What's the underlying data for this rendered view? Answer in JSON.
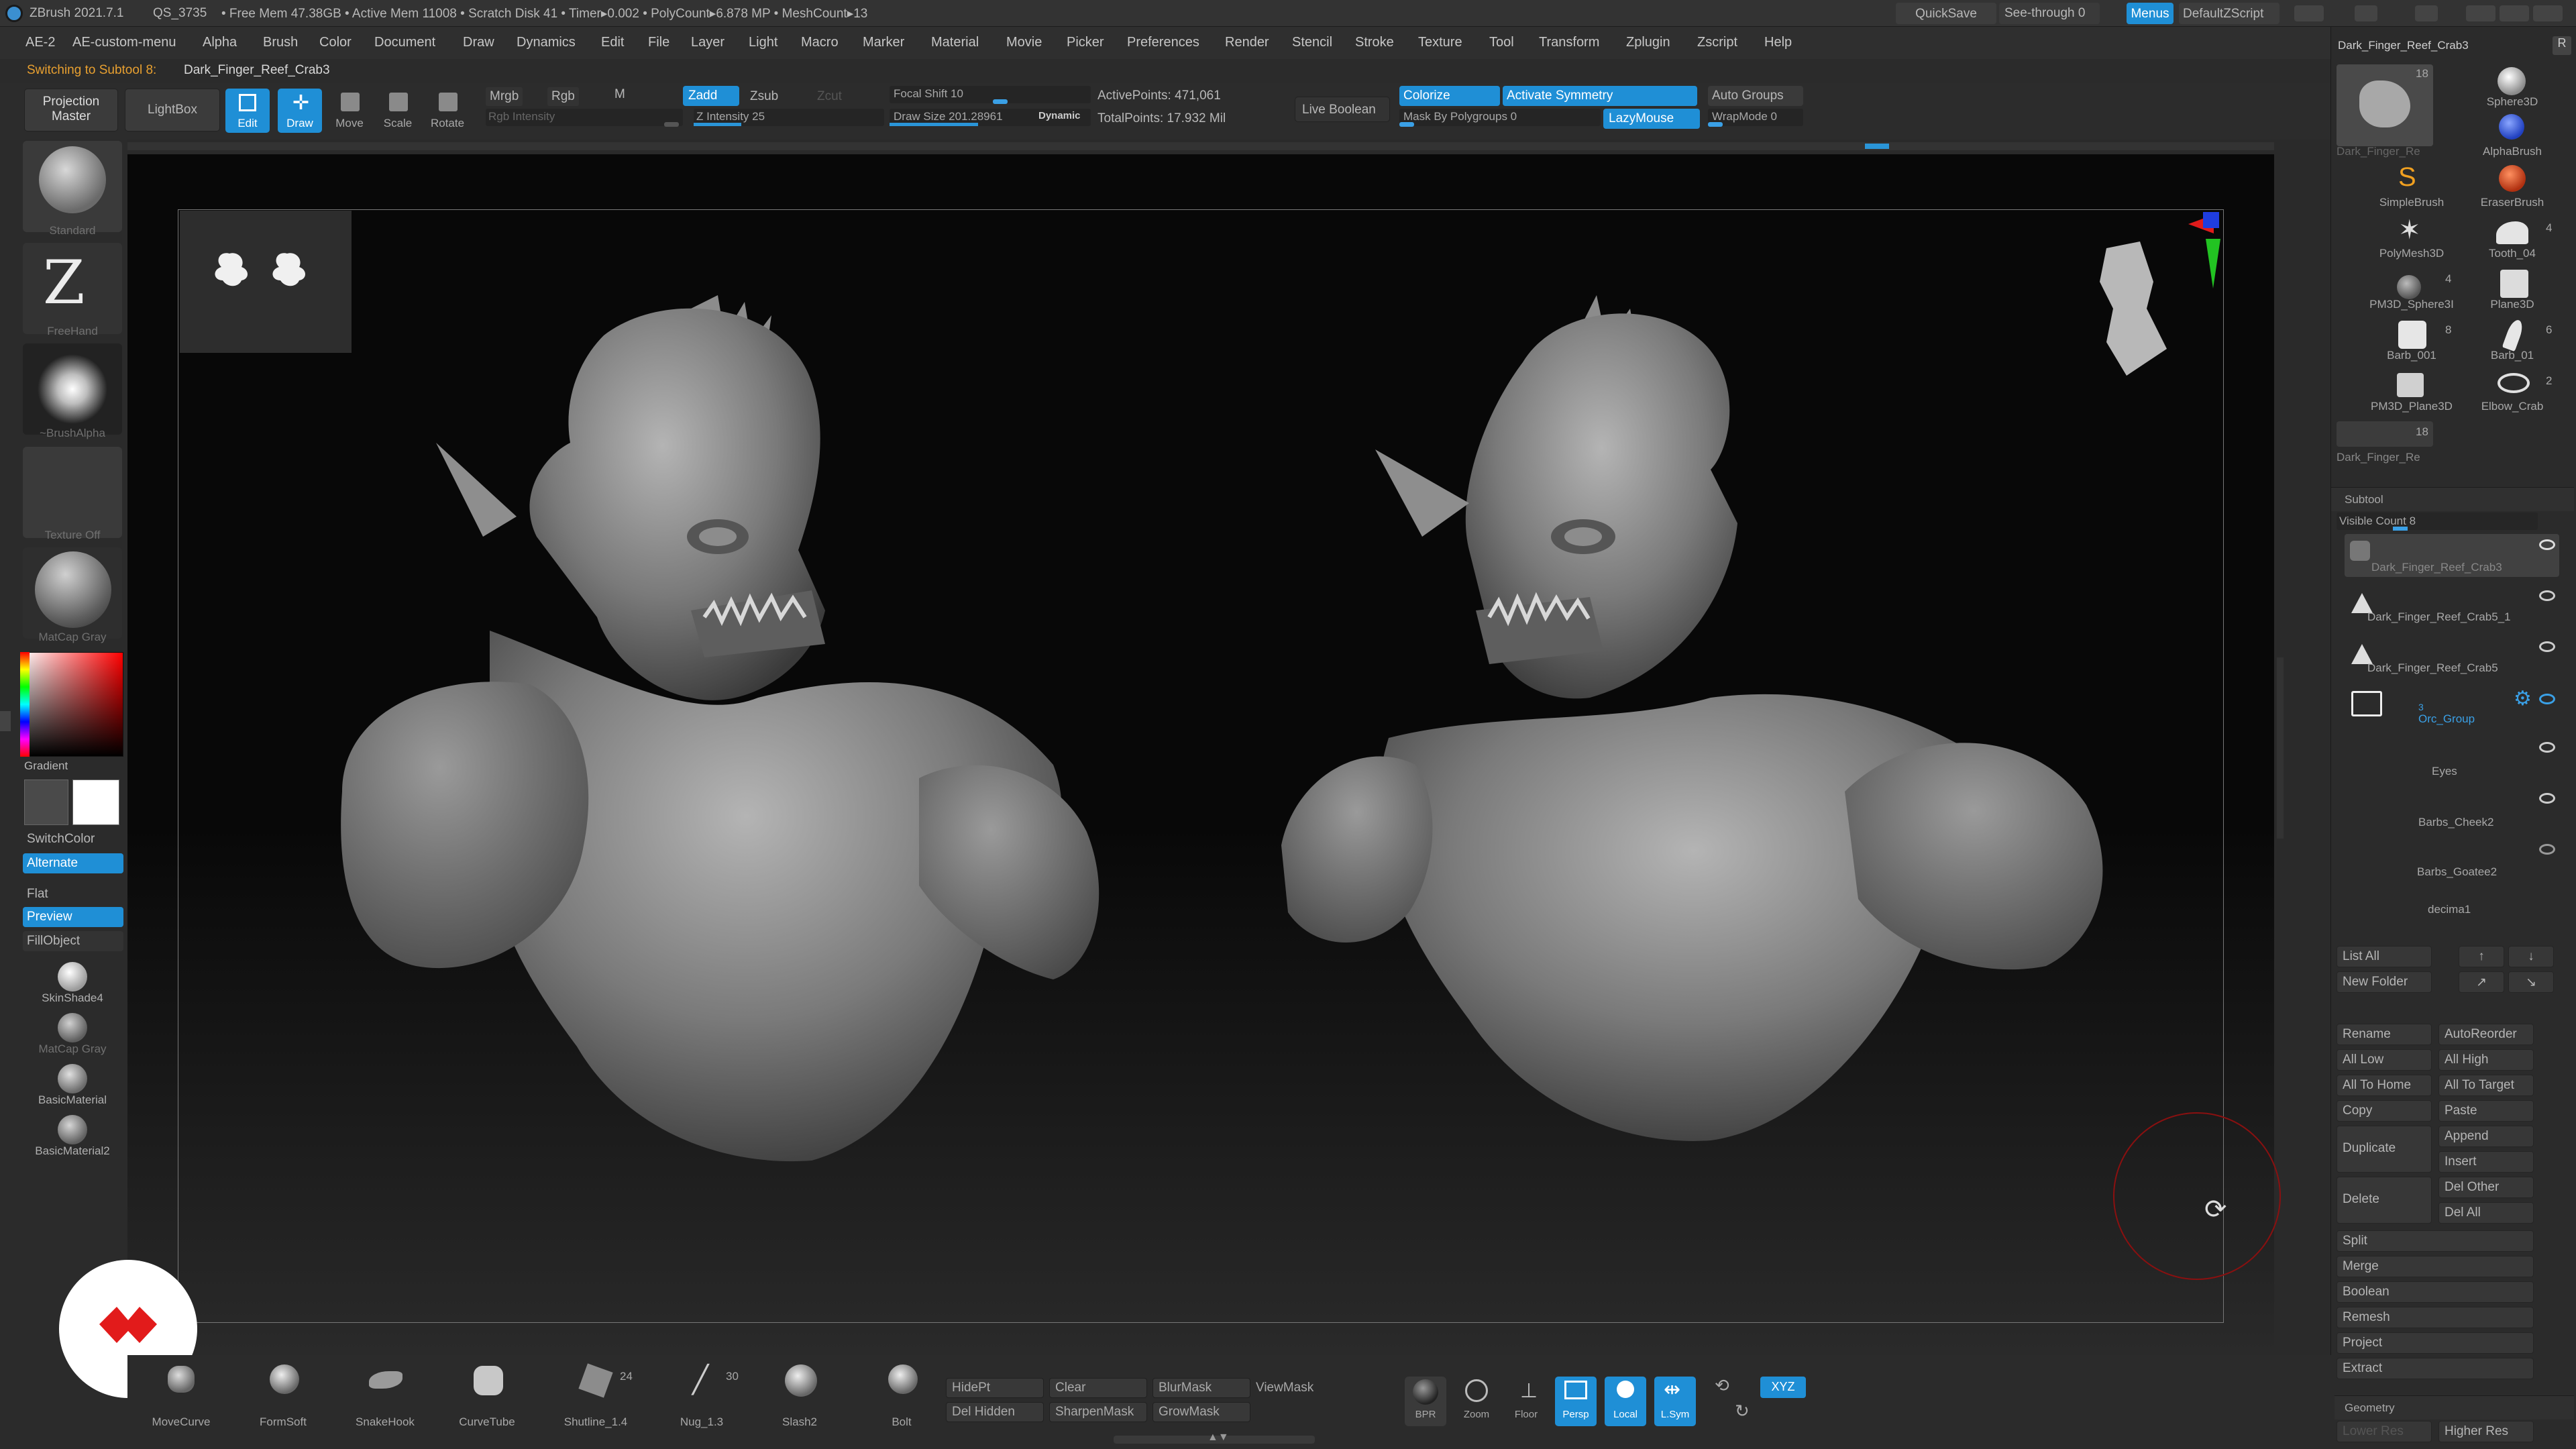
{
  "titlebar": {
    "app": "ZBrush 2021.7.1",
    "qs": "QS_3735",
    "stats": "• Free Mem 47.38GB • Active Mem 11008 • Scratch Disk 41 • Timer▸0.002 • PolyCount▸6.878 MP • MeshCount▸13",
    "quicksave": "QuickSave",
    "see_through": "See-through  0",
    "menus": "Menus",
    "default_zscript": "DefaultZScript"
  },
  "menubar": {
    "items": [
      "AE-2",
      "AE-custom-menu",
      "Alpha",
      "Brush",
      "Color",
      "Document",
      "Draw",
      "Dynamics",
      "Edit",
      "File",
      "Layer",
      "Light",
      "Macro",
      "Marker",
      "Material",
      "Movie",
      "Picker",
      "Preferences",
      "Render",
      "Stencil",
      "Stroke",
      "Texture",
      "Tool",
      "Transform",
      "Zplugin",
      "Zscript",
      "Help"
    ]
  },
  "notice": {
    "switching": "Switching to Subtool 8:",
    "subtool": "Dark_Finger_Reef_Crab3"
  },
  "toolbar": {
    "projection_master": "Projection Master",
    "lightbox": "LightBox",
    "edit": "Edit",
    "draw": "Draw",
    "move": "Move",
    "scale": "Scale",
    "rotate": "Rotate",
    "mrgb": "Mrgb",
    "rgb": "Rgb",
    "m": "M",
    "rgb_intensity": "Rgb Intensity",
    "zadd": "Zadd",
    "zsub": "Zsub",
    "zcut": "Zcut",
    "z_intensity": "Z Intensity 25",
    "focal_shift": "Focal Shift 10",
    "draw_size": "Draw Size 201.28961",
    "dynamic": "Dynamic",
    "active_points": "ActivePoints: 471,061",
    "total_points": "TotalPoints: 17.932 Mil",
    "live_boolean": "Live Boolean",
    "colorize": "Colorize",
    "activate_symmetry": "Activate Symmetry",
    "auto_groups": "Auto Groups",
    "mask_by_polygroups": "Mask By Polygroups 0",
    "lazymouse": "LazyMouse",
    "wrapmode": "WrapMode 0"
  },
  "leftshelf": {
    "brush1": "Standard",
    "brush2": "FreeHand",
    "alpha": "~BrushAlpha",
    "texture": "Texture Off",
    "material": "MatCap Gray",
    "gradient": "Gradient",
    "switchcolor": "SwitchColor",
    "alternate": "Alternate",
    "flat": "Flat",
    "preview": "Preview",
    "fillobject": "FillObject",
    "mat1": "SkinShade4",
    "mat2": "MatCap Gray",
    "mat3": "BasicMaterial",
    "mat4": "BasicMaterial2",
    "colors": {
      "main": "#4a4a4a",
      "secondary": "#ffffff"
    }
  },
  "rightpanel": {
    "current_tool": "Dark_Finger_Reef_Crab3",
    "tools": [
      {
        "label": "Dark_Finger_Re",
        "count": "18"
      },
      {
        "label": "Sphere3D",
        "count": ""
      },
      {
        "label": "AlphaBrush",
        "count": ""
      },
      {
        "label": "SimpleBrush",
        "count": ""
      },
      {
        "label": "EraserBrush",
        "count": ""
      },
      {
        "label": "PolyMesh3D",
        "count": ""
      },
      {
        "label": "Tooth_04",
        "count": "4"
      },
      {
        "label": "PM3D_Sphere3I",
        "count": "4"
      },
      {
        "label": "Plane3D",
        "count": ""
      },
      {
        "label": "Barb_001",
        "count": "8"
      },
      {
        "label": "Barb_01",
        "count": "6"
      },
      {
        "label": "PM3D_Plane3D",
        "count": ""
      },
      {
        "label": "Elbow_Crab",
        "count": "2"
      },
      {
        "label": "Dark_Finger_Re",
        "count": "18"
      }
    ],
    "subtool_title": "Subtool",
    "visible_count": "Visible Count 8",
    "subtools": [
      "Dark_Finger_Reef_Crab3",
      "Dark_Finger_Reef_Crab5_1",
      "Dark_Finger_Reef_Crab5",
      "Orc_Group",
      "Eyes",
      "Barbs_Cheek2",
      "Barbs_Goatee2",
      "decima1"
    ],
    "folder_count": "3",
    "list_all": "List All",
    "new_folder": "New Folder",
    "rename": "Rename",
    "autoreorder": "AutoReorder",
    "all_low": "All Low",
    "all_high": "All High",
    "all_to_home": "All To Home",
    "all_to_target": "All To Target",
    "copy": "Copy",
    "paste": "Paste",
    "duplicate": "Duplicate",
    "append": "Append",
    "insert": "Insert",
    "delete": "Delete",
    "del_other": "Del Other",
    "del_all": "Del All",
    "split": "Split",
    "merge": "Merge",
    "boolean": "Boolean",
    "remesh": "Remesh",
    "project": "Project",
    "extract": "Extract",
    "geometry": "Geometry",
    "lower_res": "Lower Res",
    "higher_res": "Higher Res"
  },
  "bottomshelf": {
    "brushes": [
      {
        "label": "MoveCurve",
        "count": ""
      },
      {
        "label": "FormSoft",
        "count": ""
      },
      {
        "label": "SnakeHook",
        "count": ""
      },
      {
        "label": "CurveTube",
        "count": ""
      },
      {
        "label": "Shutline_1.4",
        "count": "24"
      },
      {
        "label": "Nug_1.3",
        "count": "30"
      },
      {
        "label": "Slash2",
        "count": ""
      },
      {
        "label": "Bolt",
        "count": ""
      }
    ],
    "hidept": "HidePt",
    "clear": "Clear",
    "blurmask": "BlurMask",
    "viewmask": "ViewMask",
    "del_hidden": "Del Hidden",
    "sharpenmask": "SharpenMask",
    "growmask": "GrowMask",
    "bpr": "BPR",
    "zoom": "Zoom",
    "floor": "Floor",
    "persp": "Persp",
    "local": "Local",
    "lsym": "L.Sym",
    "xyz": "XYZ"
  },
  "accent": "#1f8fd6"
}
